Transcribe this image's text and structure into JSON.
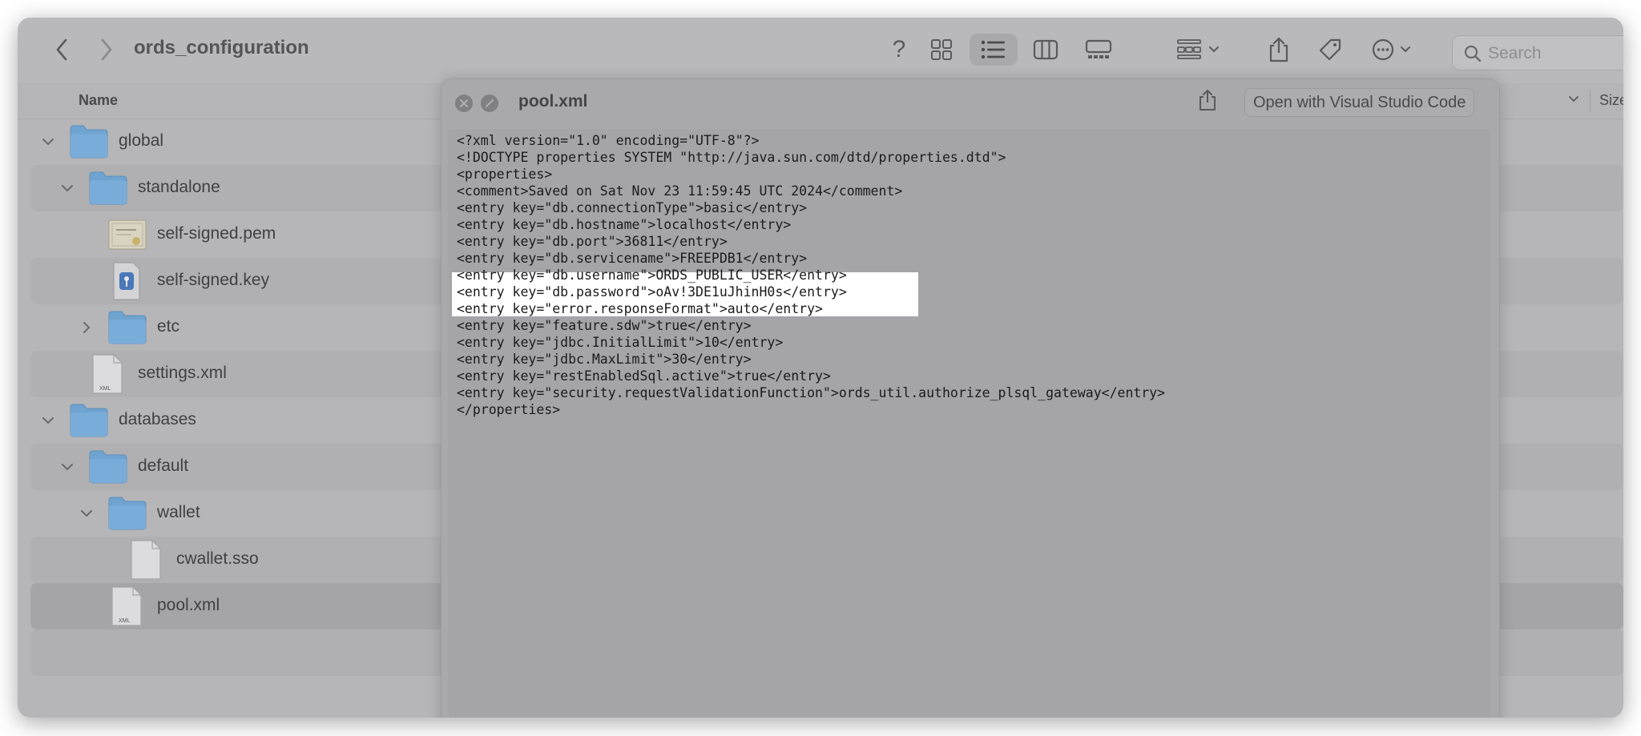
{
  "finder": {
    "title": "ords_configuration",
    "search_placeholder": "Search",
    "columns": {
      "name": "Name",
      "size": "Size"
    },
    "rows": [
      {
        "label": "global",
        "type": "folder",
        "expanded": true
      },
      {
        "label": "standalone",
        "type": "folder",
        "expanded": true
      },
      {
        "label": "self-signed.pem",
        "type": "certificate"
      },
      {
        "label": "self-signed.key",
        "type": "key-file"
      },
      {
        "label": "etc",
        "type": "folder",
        "expanded": false
      },
      {
        "label": "settings.xml",
        "type": "xml-file"
      },
      {
        "label": "databases",
        "type": "folder",
        "expanded": true
      },
      {
        "label": "default",
        "type": "folder",
        "expanded": true
      },
      {
        "label": "wallet",
        "type": "folder",
        "expanded": true
      },
      {
        "label": "cwallet.sso",
        "type": "file"
      },
      {
        "label": "pool.xml",
        "type": "xml-file",
        "selected": true
      }
    ],
    "file_badge": "XML"
  },
  "quicklook": {
    "title": "pool.xml",
    "open_with_label": "Open with Visual Studio Code",
    "lines": [
      "<?xml version=\"1.0\" encoding=\"UTF-8\"?>",
      "<!DOCTYPE properties SYSTEM \"http://java.sun.com/dtd/properties.dtd\">",
      "<properties>",
      "<comment>Saved on Sat Nov 23 11:59:45 UTC 2024</comment>",
      "<entry key=\"db.connectionType\">basic</entry>",
      "<entry key=\"db.hostname\">localhost</entry>",
      "<entry key=\"db.port\">36811</entry>",
      "<entry key=\"db.servicename\">FREEPDB1</entry>",
      "<entry key=\"db.username\">ORDS_PUBLIC_USER</entry>",
      "<entry key=\"db.password\">oAv!3DE1uJhinH0s</entry>",
      "<entry key=\"error.responseFormat\">auto</entry>",
      "<entry key=\"feature.sdw\">true</entry>",
      "<entry key=\"jdbc.InitialLimit\">10</entry>",
      "<entry key=\"jdbc.MaxLimit\">30</entry>",
      "<entry key=\"restEnabledSql.active\">true</entry>",
      "<entry key=\"security.requestValidationFunction\">ords_util.authorize_plsql_gateway</entry>",
      "</properties>"
    ]
  },
  "colors": {
    "folder_blue": "#6fa3d0",
    "window_bg": "#b6b6b8",
    "highlight": "#ffffff"
  }
}
